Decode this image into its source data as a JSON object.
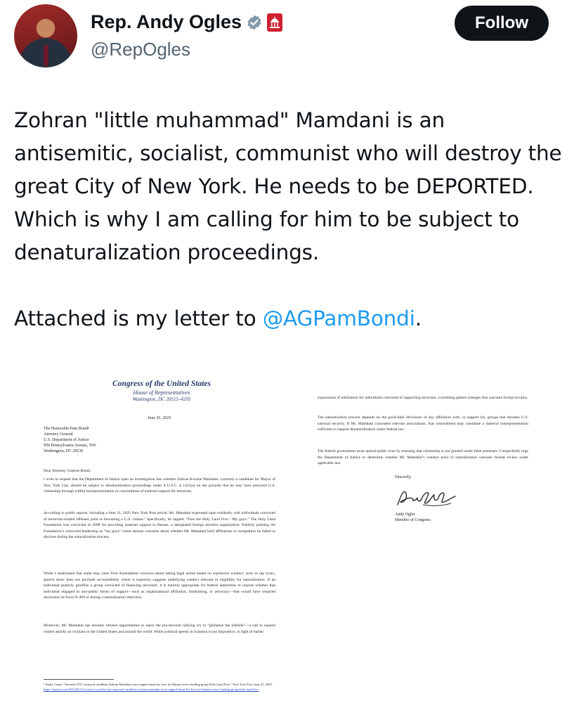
{
  "author": {
    "name": "Rep. Andy Ogles",
    "handle": "@RepOgles",
    "verified_icon": "verified-badge-icon",
    "affiliation_icon": "us-capitol-icon"
  },
  "follow_label": "Follow",
  "tweet": {
    "body": "Zohran \"little muhammad\" Mamdani is an antisemitic, socialist, communist who will destroy the great City of New York. He needs to be DEPORTED. Which is why I am calling for him to be subject to denaturalization proceedings.",
    "attached_prefix": "Attached is my letter to ",
    "mention": "@AGPamBondi",
    "attached_suffix": "."
  },
  "letter": {
    "letterhead_1": "Congress of the United States",
    "letterhead_2": "House of Representatives",
    "letterhead_3": "Washington, DC 20515–4205",
    "date": "June 26, 2025",
    "address": "The Honorable Pam Bondi\nAttorney General\nU.S. Department of Justice\n950 Pennsylvania Avenue, NW\nWashington, DC 20530",
    "salutation": "Dear Attorney General Bondi,",
    "p1": "I write to request that the Department of Justice open an investigation into whether Zohran Kwame Mamdani, currently a candidate for Mayor of New York City, should be subject to denaturalization proceedings under 8 U.S.C. § 1451(a) on the grounds that he may have procured U.S. citizenship through willful misrepresentation or concealment of material support for terrorism.",
    "p2": "According to public reports, including a June 21, 2025 New York Post article, Mr. Mamdani expressed open solidarity with individuals convicted of terrorism-related offenses prior to becoming a U.S. citizen.¹ Specifically, he rapped: “Free the Holy Land Five / My guys.” The Holy Land Foundation was convicted in 2008 for providing material support to Hamas, a designated foreign terrorist organization. Publicly praising the Foundation’s convicted leadership as “my guys” raises serious concerns about whether Mr. Mamdani held affiliations or sympathies he failed to disclose during the naturalization process.",
    "p3": "While I understand that some may raise First Amendment concerns about taking legal action based on expressive conduct, such as rap lyrics, speech alone does not preclude accountability where it expressly suggests underlying conduct relevant to eligibility for naturalization. If an individual publicly glorifies a group convicted of financing terrorism, it is entirely appropriate for federal authorities to inquire whether that individual engaged in non-public forms of support—such as organizational affiliation, fundraising, or advocacy—that would have required disclosure on Form N-400 or during a naturalization interview.",
    "p4": "Moreover, Mr. Mamdani has recently refused opportunities to reject the pro-terrorist rallying cry to “globalize the intifada”—a call to expand violent attacks on civilians to the United States and around the world. While political speech in isolation is not dispositive, in light of earlier",
    "footnote_text": "¹ Emily Crane, “Socialist NYC mayoral candidate Zohran Mamdani once rapped about his love for Hamas terror-funding group Holy Land Five,” New York Post, June 21, 2025. ",
    "footnote_link": "https://nypost.com/2025/06/21/us-news/socialist-nyc-mayoral-candidate-zohran-mamdani-once-rapped-about-his-love-for-hamas-terror-funding-group-holy-land-five/",
    "r1": "expressions of admiration for individuals convicted of supporting terrorism, a troubling pattern emerges that warrants formal scrutiny.",
    "r2": "The naturalization process depends on the good-faith disclosure of any affiliation with, or support for, groups that threaten U.S. national security. If Mr. Mamdani concealed relevant associations, that concealment may constitute a material misrepresentation sufficient to support denaturalization under federal law.",
    "r3": "The federal government must uphold public trust by ensuring that citizenship is not granted under false pretenses. I respectfully urge the Department of Justice to determine whether Mr. Mamdani’s conduct prior to naturalization warrants formal review under applicable law.",
    "closing": "Sincerely,",
    "signature": "Andy Ogles",
    "signer": "Andy Ogles\nMember of Congress"
  },
  "colors": {
    "text": "#0f1419",
    "secondary": "#536471",
    "mention": "#1d9bf0",
    "verified_badge": "#829aab",
    "capitol_badge": "#cf2030",
    "follow_bg": "#0f1419"
  }
}
